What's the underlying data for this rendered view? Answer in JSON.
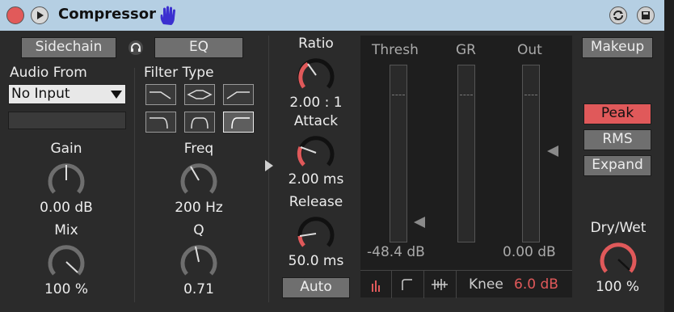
{
  "device": {
    "title": "Compressor"
  },
  "left": {
    "sidechain_label": "Sidechain",
    "eq_label": "EQ",
    "audio_from_label": "Audio From",
    "audio_from_value": "No Input",
    "filter_type_label": "Filter Type",
    "gain_label": "Gain",
    "gain_value": "0.00 dB",
    "mix_label": "Mix",
    "mix_value": "100 %",
    "freq_label": "Freq",
    "freq_value": "200 Hz",
    "q_label": "Q",
    "q_value": "0.71"
  },
  "center": {
    "ratio_label": "Ratio",
    "ratio_value": "2.00 : 1",
    "attack_label": "Attack",
    "attack_value": "2.00 ms",
    "release_label": "Release",
    "release_value": "50.0 ms",
    "auto_label": "Auto"
  },
  "display": {
    "thresh_label": "Thresh",
    "gr_label": "GR",
    "out_label": "Out",
    "thresh_value": "-48.4 dB",
    "out_value": "0.00 dB",
    "knee_label": "Knee",
    "knee_value": "6.0 dB"
  },
  "right": {
    "makeup_label": "Makeup",
    "peak_label": "Peak",
    "rms_label": "RMS",
    "expand_label": "Expand",
    "drywet_label": "Dry/Wet",
    "drywet_value": "100 %"
  },
  "colors": {
    "accent": "#e0595a",
    "titlebar": "#b5cfe3",
    "panel": "#2b2b2b",
    "button": "#6f6f6f"
  }
}
